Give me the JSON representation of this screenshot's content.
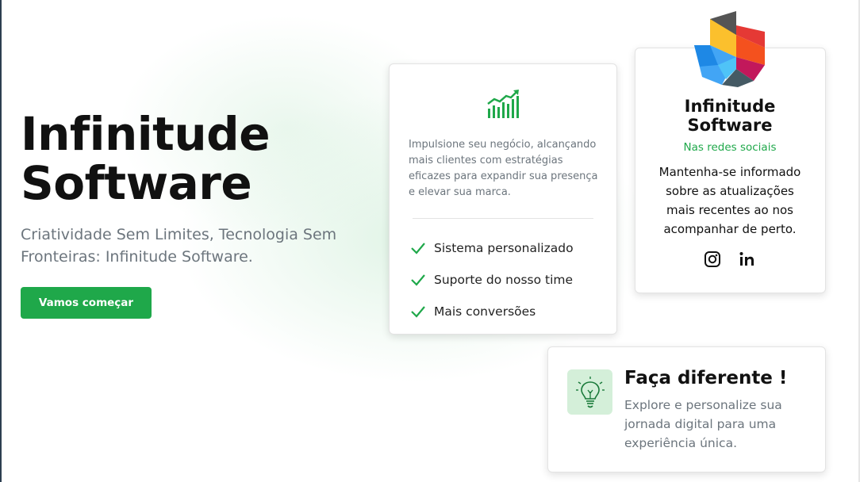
{
  "hero": {
    "title_line1": "Infinitude",
    "title_line2": "Software",
    "subtitle": "Criatividade Sem Limites, Tecnologia Sem Fronteiras: Infinitude Software.",
    "cta_label": "Vamos começar"
  },
  "card_main": {
    "icon": "growth-chart-icon",
    "description": "Impulsione seu negócio, alcançando mais clientes com estratégias eficazes para expandir sua presença e elevar sua marca.",
    "features": [
      {
        "label": "Sistema personalizado",
        "icon": "check-icon"
      },
      {
        "label": "Suporte do nosso time",
        "icon": "check-icon"
      },
      {
        "label": "Mais conversões",
        "icon": "check-icon"
      }
    ]
  },
  "card_social": {
    "logo": "infinitude-logo",
    "title_line1": "Infinitude",
    "title_line2": "Software",
    "subtitle": "Nas redes sociais",
    "description": "Mantenha-se informado sobre as atualizações mais recentes ao nos acompanhar de perto.",
    "icons": [
      "instagram-icon",
      "linkedin-icon"
    ]
  },
  "card_diff": {
    "icon": "lightbulb-icon",
    "title": "Faça diferente !",
    "description": "Explore e personalize sua jornada digital para uma experiência única."
  },
  "colors": {
    "accent": "#1fa84a",
    "muted_text": "#6c757d",
    "icon_bg": "#d4efd9"
  }
}
